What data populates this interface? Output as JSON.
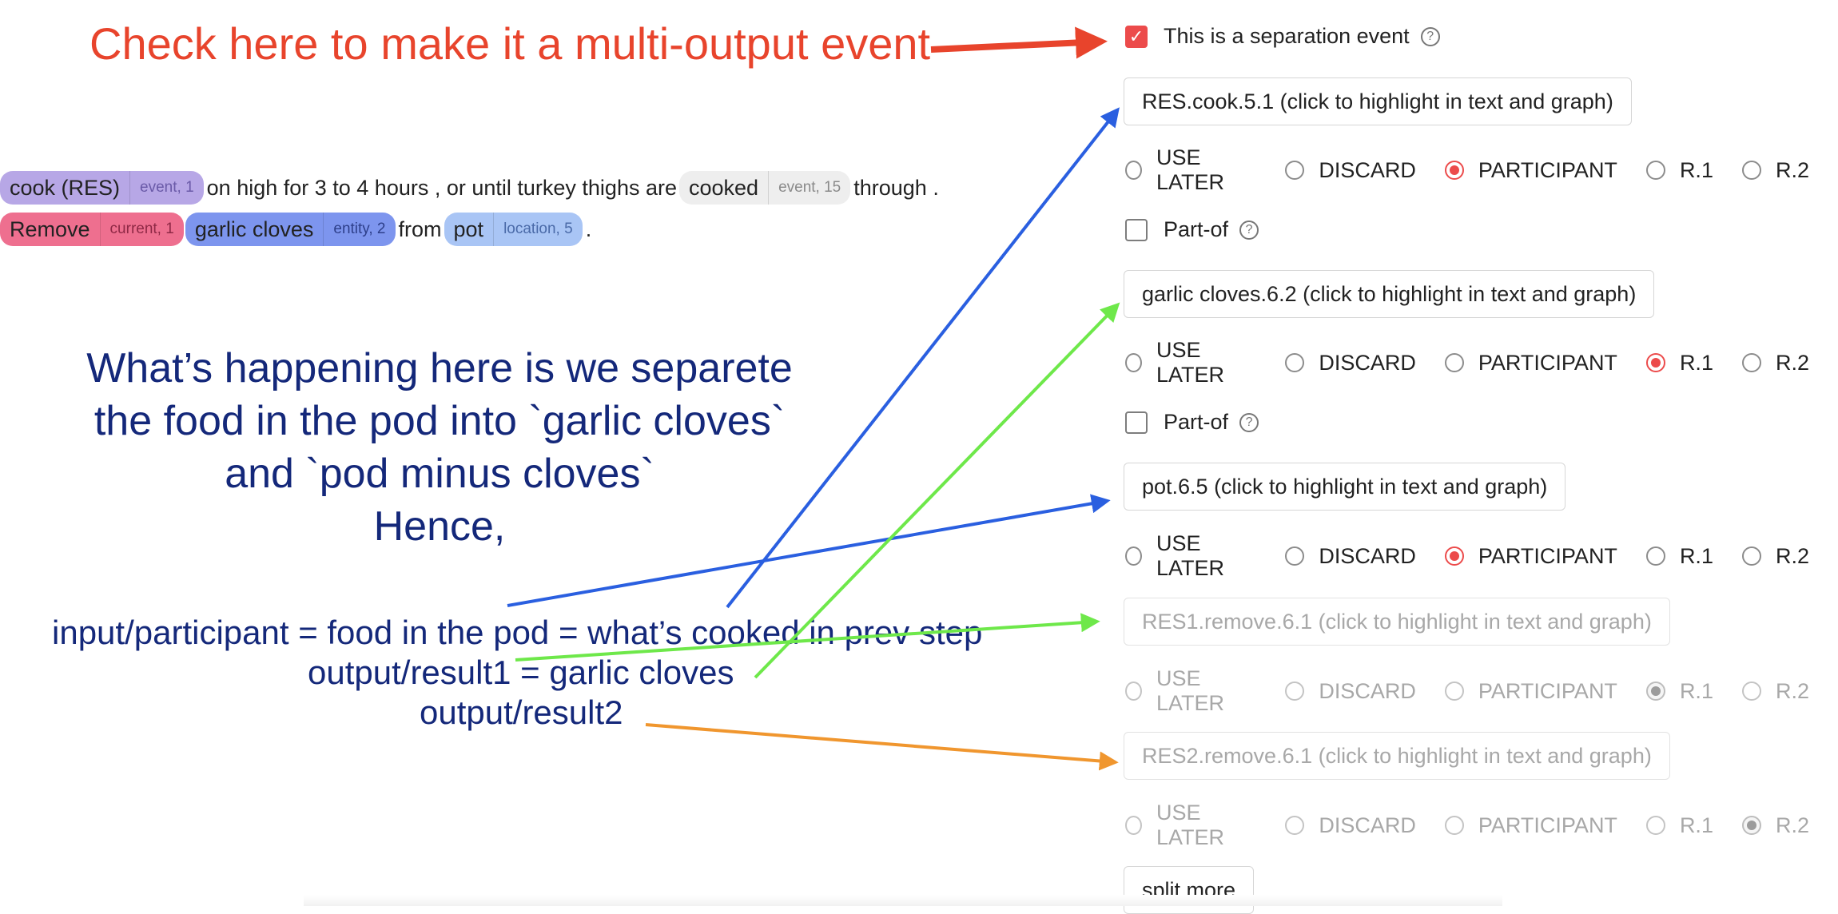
{
  "annotations": {
    "multi_output_hint": "Check here to make it a multi-output event",
    "explanation": [
      "What’s happening here is we separete",
      "the food in the pod into `garlic cloves`",
      "and `pod minus cloves`",
      "Hence,"
    ],
    "formulas": {
      "participant": "input/participant = food in the pod = what’s cooked in prev step",
      "result1": "output/result1 = garlic cloves",
      "result2": "output/result2"
    },
    "arrow_colors": {
      "red": "#e8442c",
      "blue": "#2a5fe0",
      "green": "#6ee84a",
      "orange": "#f0962e"
    }
  },
  "sentence1": {
    "tag_cook": {
      "word": "cook (RES)",
      "meta": "event, 1"
    },
    "text_a": "on high for 3 to 4 hours , or until turkey thighs are",
    "tag_cooked": {
      "word": "cooked",
      "meta": "event, 15"
    },
    "text_b": "through ."
  },
  "sentence2": {
    "tag_remove": {
      "word": "Remove",
      "meta": "current, 1"
    },
    "tag_garlic": {
      "word": "garlic cloves",
      "meta": "entity, 2"
    },
    "text_a": "from",
    "tag_pot": {
      "word": "pot",
      "meta": "location, 5"
    },
    "text_b": "."
  },
  "form": {
    "separation_label": "This is a separation event",
    "separation_checked": true,
    "help_glyph": "?",
    "radio_labels": [
      "USE LATER",
      "DISCARD",
      "PARTICIPANT",
      "R.1",
      "R.2"
    ],
    "part_of_label": "Part-of",
    "fields": {
      "res_cook": "RES.cook.5.1 (click to highlight in text and graph)",
      "garlic": "garlic cloves.6.2 (click to highlight in text and graph)",
      "pot": "pot.6.5 (click to highlight in text and graph)",
      "res1": "RES1.remove.6.1 (click to highlight in text and graph)",
      "res2": "RES2.remove.6.1 (click to highlight in text and graph)"
    },
    "selected": {
      "res_cook": "PARTICIPANT",
      "garlic": "R.1",
      "pot": "PARTICIPANT",
      "res1": "R.1",
      "res2": "R.2"
    },
    "split_more_label": "split more"
  },
  "colors": {
    "accent": "#ec4b4b",
    "tag_purple": "#b7a7e6",
    "tag_pink": "#ee6f8f",
    "tag_blue": "#7d95ee",
    "tag_lightblue": "#a9c5f5",
    "tag_grey": "#eeeeee"
  }
}
